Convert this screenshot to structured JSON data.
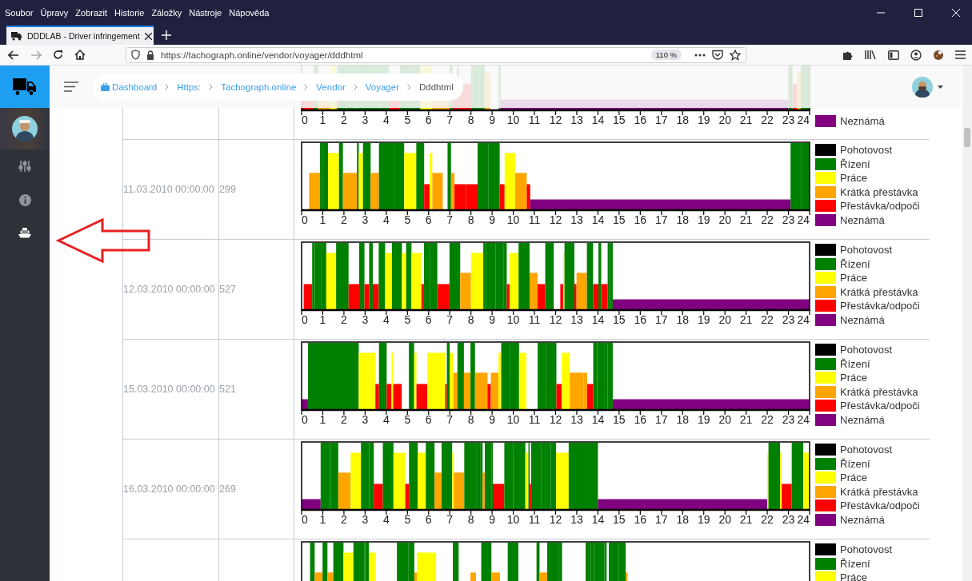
{
  "browser": {
    "menu": [
      "Soubor",
      "Úpravy",
      "Zobrazit",
      "Historie",
      "Záložky",
      "Nástroje",
      "Nápověda"
    ],
    "tab": {
      "title": "DDDLAB - Driver infringement"
    },
    "url": "https://tachograph.online/vendor/voyager/dddhtml",
    "zoom": "110 %"
  },
  "sidebar": {
    "items": [
      {
        "kind": "sliders",
        "selected": false
      },
      {
        "kind": "info",
        "selected": false
      },
      {
        "kind": "ship",
        "selected": true
      }
    ]
  },
  "breadcrumb": [
    {
      "label": "Dashboard",
      "current": false
    },
    {
      "label": "Https:",
      "current": false
    },
    {
      "label": "Tachograph.online",
      "current": false
    },
    {
      "label": "Vendor",
      "current": false
    },
    {
      "label": "Voyager",
      "current": false
    },
    {
      "label": "Dddhtml",
      "current": true
    }
  ],
  "rows": [
    {
      "kind": "top",
      "ticks": [
        "0",
        "1",
        "2",
        "3",
        "4",
        "5",
        "6",
        "7",
        "8",
        "9",
        "10",
        "11",
        "12",
        "13",
        "14",
        "15",
        "16",
        "17",
        "18",
        "19",
        "20",
        "21",
        "22",
        "23",
        "24"
      ],
      "legend": [
        {
          "label": "Neznámá",
          "color": "#800080"
        }
      ]
    },
    {
      "kind": "full",
      "date": "11.03.2010 00:00:00",
      "count": "299",
      "ticks": [
        "0",
        "1",
        "2",
        "3",
        "4",
        "5",
        "6",
        "7",
        "8",
        "9",
        "10",
        "11",
        "12",
        "13",
        "14",
        "15",
        "16",
        "17",
        "18",
        "19",
        "20",
        "21",
        "22",
        "23",
        "24"
      ],
      "legend": [
        {
          "label": "Pohotovost",
          "color": "#000000"
        },
        {
          "label": "Řízení",
          "color": "#008000"
        },
        {
          "label": "Práce",
          "color": "#ffff00"
        },
        {
          "label": "Krátká přestávka",
          "color": "#ffa500"
        },
        {
          "label": "Přestávka/odpoči",
          "color": "#ff0000"
        },
        {
          "label": "Neznámá",
          "color": "#800080"
        }
      ]
    },
    {
      "kind": "full",
      "date": "12.03.2010 00:00:00",
      "count": "527",
      "ticks": [
        "0",
        "1",
        "2",
        "3",
        "4",
        "5",
        "6",
        "7",
        "8",
        "9",
        "10",
        "11",
        "12",
        "13",
        "14",
        "15",
        "16",
        "17",
        "18",
        "19",
        "20",
        "21",
        "22",
        "23",
        "24"
      ],
      "legend": [
        {
          "label": "Pohotovost",
          "color": "#000000"
        },
        {
          "label": "Řízení",
          "color": "#008000"
        },
        {
          "label": "Práce",
          "color": "#ffff00"
        },
        {
          "label": "Krátká přestávka",
          "color": "#ffa500"
        },
        {
          "label": "Přestávka/odpoči",
          "color": "#ff0000"
        },
        {
          "label": "Neznámá",
          "color": "#800080"
        }
      ]
    },
    {
      "kind": "full",
      "date": "15.03.2010 00:00:00",
      "count": "521",
      "ticks": [
        "0",
        "1",
        "2",
        "3",
        "4",
        "5",
        "6",
        "7",
        "8",
        "9",
        "10",
        "11",
        "12",
        "13",
        "14",
        "15",
        "16",
        "17",
        "18",
        "19",
        "20",
        "21",
        "22",
        "23",
        "24"
      ],
      "legend": [
        {
          "label": "Pohotovost",
          "color": "#000000"
        },
        {
          "label": "Řízení",
          "color": "#008000"
        },
        {
          "label": "Práce",
          "color": "#ffff00"
        },
        {
          "label": "Krátká přestávka",
          "color": "#ffa500"
        },
        {
          "label": "Přestávka/odpoči",
          "color": "#ff0000"
        },
        {
          "label": "Neznámá",
          "color": "#800080"
        }
      ]
    },
    {
      "kind": "full",
      "date": "16.03.2010 00:00:00",
      "count": "269",
      "ticks": [
        "0",
        "1",
        "2",
        "3",
        "4",
        "5",
        "6",
        "7",
        "8",
        "9",
        "10",
        "11",
        "12",
        "13",
        "14",
        "15",
        "16",
        "17",
        "18",
        "19",
        "20",
        "21",
        "22",
        "23",
        "24"
      ],
      "legend": [
        {
          "label": "Pohotovost",
          "color": "#000000"
        },
        {
          "label": "Řízení",
          "color": "#008000"
        },
        {
          "label": "Práce",
          "color": "#ffff00"
        },
        {
          "label": "Krátká přestávka",
          "color": "#ffa500"
        },
        {
          "label": "Přestávka/odpoči",
          "color": "#ff0000"
        },
        {
          "label": "Neznámá",
          "color": "#800080"
        }
      ]
    },
    {
      "kind": "bottom",
      "legend": [
        {
          "label": "Pohotovost",
          "color": "#000000"
        },
        {
          "label": "Řízení",
          "color": "#008000"
        },
        {
          "label": "Práce",
          "color": "#ffff00"
        }
      ]
    }
  ]
}
